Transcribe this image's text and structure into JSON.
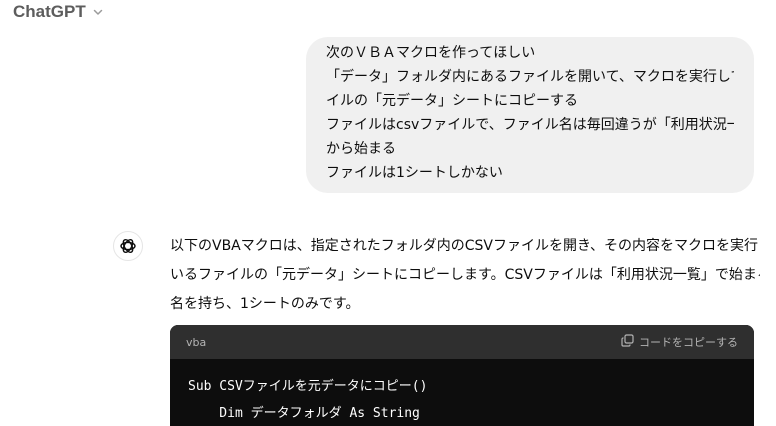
{
  "header": {
    "model_name": "ChatGPT",
    "chevron_icon": "chevron-down-icon"
  },
  "user_message": {
    "lines": [
      "次のＶＢＡマクロを作ってほしい",
      "「データ」フォルダ内にあるファイルを開いて、マクロを実行しているファ",
      "イルの「元データ」シートにコピーする",
      "ファイルはcsvファイルで、ファイル名は毎回違うが「利用状況一覧」",
      "から始まる",
      "ファイルは1シートしかない"
    ]
  },
  "assistant_message": {
    "avatar_icon": "openai-logo-icon",
    "lines": [
      "以下のVBAマクロは、指定されたフォルダ内のCSVファイルを開き、その内容をマクロを実行して",
      "いるファイルの「元データ」シートにコピーします。CSVファイルは「利用状況一覧」で始まるファイル",
      "名を持ち、1シートのみです。"
    ]
  },
  "code_block": {
    "language": "vba",
    "copy_label": "コードをコピーする",
    "copy_icon": "copy-icon",
    "lines": [
      "Sub CSVファイルを元データにコピー()",
      "    Dim データフォルダ As String"
    ]
  },
  "colors": {
    "user_bubble_bg": "#f0f0f0",
    "code_header_bg": "#2f2f2f",
    "code_body_bg": "#0d0d0d",
    "model_name_text": "#5d5d5d"
  }
}
